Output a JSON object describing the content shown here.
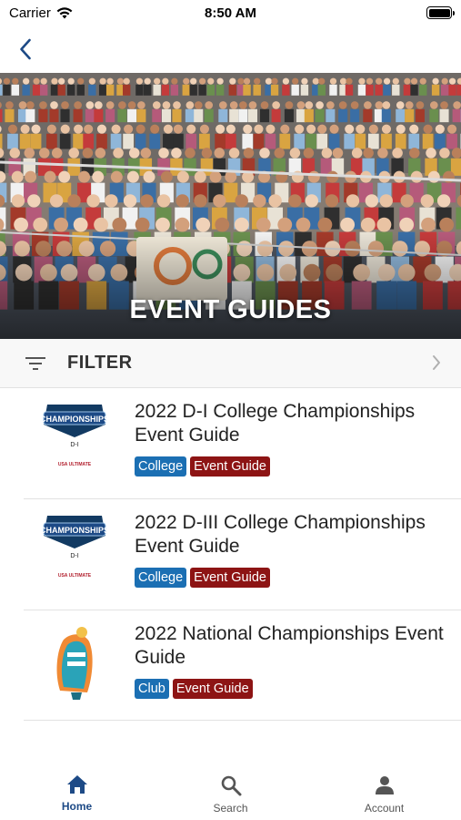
{
  "status_bar": {
    "carrier": "Carrier",
    "time": "8:50 AM"
  },
  "nav": {
    "back_icon": "chevron-left-icon"
  },
  "hero": {
    "title": "EVENT GUIDES"
  },
  "filter": {
    "label": "FILTER",
    "icon": "filter-icon"
  },
  "guides": [
    {
      "title": "2022 D-I College Championships Event Guide",
      "logo_text": "CHAMPIONSHIPS",
      "logo_sub": "D-I",
      "logo_brand": "USA ULTIMATE",
      "tags": [
        {
          "label": "College",
          "color": "#1b6fb3"
        },
        {
          "label": "Event Guide",
          "color": "#8d1414"
        }
      ]
    },
    {
      "title": "2022 D-III College Championships Event Guide",
      "logo_text": "CHAMPIONSHIPS",
      "logo_sub": "D-I",
      "logo_brand": "USA ULTIMATE",
      "tags": [
        {
          "label": "College",
          "color": "#1b6fb3"
        },
        {
          "label": "Event Guide",
          "color": "#8d1414"
        }
      ]
    },
    {
      "title": "2022 National Championships Event Guide",
      "tags": [
        {
          "label": "Club",
          "color": "#1b6fb3"
        },
        {
          "label": "Event Guide",
          "color": "#8d1414"
        }
      ]
    }
  ],
  "tabs": {
    "home": {
      "label": "Home",
      "icon": "home-icon"
    },
    "search": {
      "label": "Search",
      "icon": "search-icon"
    },
    "account": {
      "label": "Account",
      "icon": "person-icon"
    }
  },
  "colors": {
    "accent": "#1d4a86",
    "tag_blue": "#1b6fb3",
    "tag_red": "#8d1414"
  }
}
